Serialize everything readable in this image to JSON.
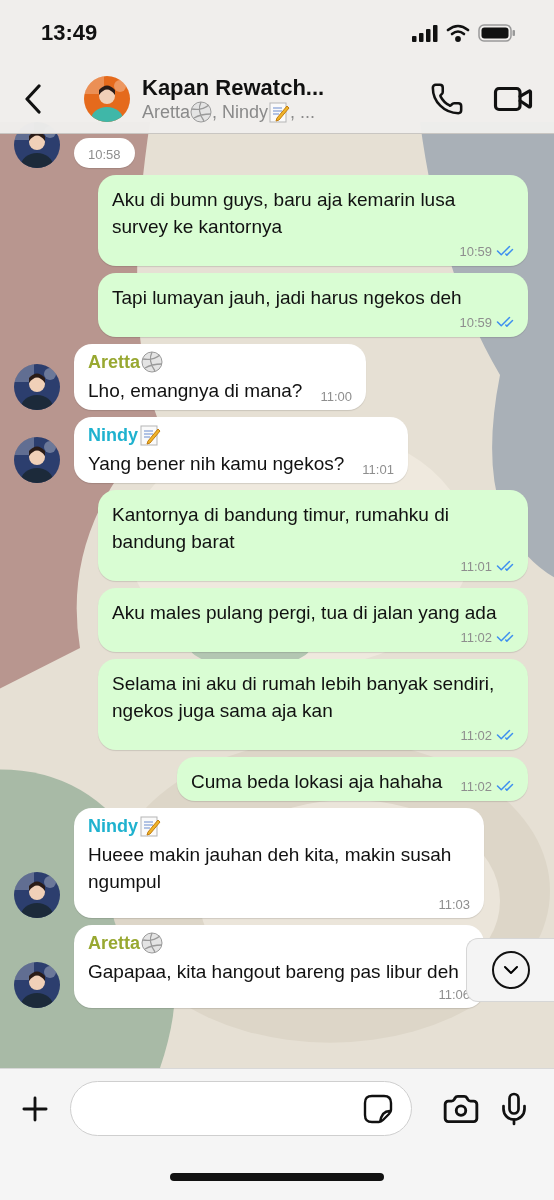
{
  "status_bar": {
    "time": "13:49"
  },
  "header": {
    "title": "Kapan Rewatch...",
    "members": [
      {
        "name": "Aretta",
        "badge": {
          "kind": "ball"
        }
      },
      {
        "name": ", Nindy",
        "badge": {
          "kind": "memo"
        }
      }
    ],
    "more": ", ..."
  },
  "messages": [
    {
      "kind": "incoming",
      "time": "10:58"
    },
    {
      "kind": "outgoing",
      "text": "Aku di bumn guys, baru aja kemarin lusa survey ke kantornya",
      "time": "10:59",
      "read": true
    },
    {
      "kind": "outgoing",
      "text": "Tapi lumayan jauh, jadi harus ngekos deh",
      "time": "10:59",
      "read": true
    },
    {
      "kind": "incoming",
      "sender": {
        "name": "Aretta",
        "badge": {
          "kind": "ball"
        },
        "color": "#98a831"
      },
      "text": "Lho, emangnya di mana?",
      "time": "11:00"
    },
    {
      "kind": "incoming",
      "sender": {
        "name": "Nindy",
        "badge": {
          "kind": "memo"
        },
        "color": "#1fb2cf"
      },
      "text": "Yang bener nih kamu ngekos?",
      "time": "11:01"
    },
    {
      "kind": "outgoing",
      "text": "Kantornya di bandung timur, rumahku di bandung barat",
      "time": "11:01",
      "read": true
    },
    {
      "kind": "outgoing",
      "text": "Aku males pulang pergi, tua di jalan yang ada",
      "time": "11:02",
      "read": true
    },
    {
      "kind": "outgoing",
      "text": "Selama ini aku di rumah lebih banyak sendiri, ngekos juga sama aja kan",
      "time": "11:02",
      "read": true
    },
    {
      "kind": "outgoing",
      "text": "Cuma beda lokasi aja hahaha",
      "time": "11:02",
      "read": true
    },
    {
      "kind": "incoming",
      "sender": {
        "name": "Nindy",
        "badge": {
          "kind": "memo"
        },
        "color": "#1fb2cf"
      },
      "text": "Hueee makin jauhan deh kita, makin susah ngumpul",
      "time": "11:03"
    },
    {
      "kind": "incoming",
      "sender": {
        "name": "Aretta",
        "badge": {
          "kind": "ball"
        },
        "color": "#98a831"
      },
      "text": "Gapapaa, kita hangout bareng pas libur deh",
      "time": "11:06"
    }
  ]
}
